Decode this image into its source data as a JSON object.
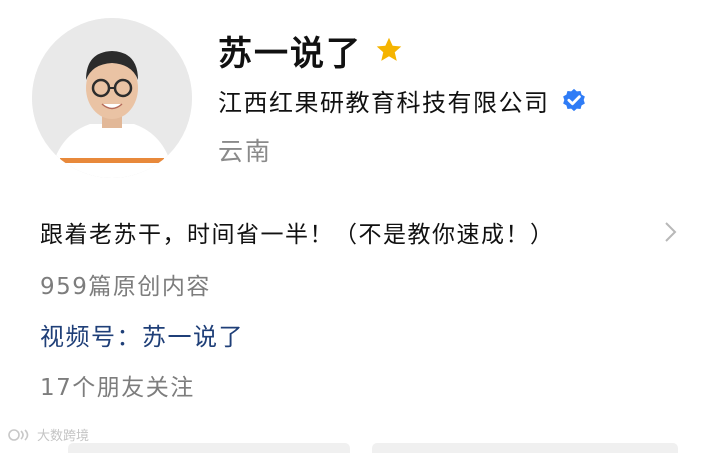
{
  "profile": {
    "name": "苏一说了",
    "organization": "江西红果研教育科技有限公司",
    "region": "云南",
    "bio": "跟着老苏干，时间省一半！（不是教你速成！）",
    "original_content_count": "959篇原创内容",
    "channel_label": "视频号：",
    "channel_name": "苏一说了",
    "friends_following": "17个朋友关注"
  },
  "icons": {
    "star": "star-icon",
    "verified": "verified-badge-icon",
    "chevron": "chevron-right-icon"
  },
  "colors": {
    "star": "#f5b400",
    "verified": "#2f7cf6",
    "channel_link": "#1f3f78",
    "secondary_text": "#7d7d7d"
  },
  "watermark": {
    "text": "大数跨境"
  }
}
